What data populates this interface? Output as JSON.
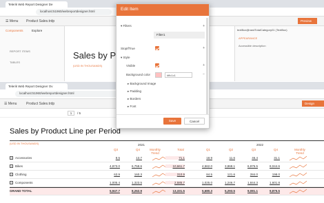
{
  "back_browser": {
    "tab": "Telerik Web Report Designer De",
    "url": "localhost:51960/webreportdesigner.html"
  },
  "back_app": {
    "menu": "Menu",
    "doc": "Product Sales.trdp",
    "left_tabs": [
      "Components",
      "Explore"
    ],
    "report_items": "REPORT ITEMS",
    "tables": "TABLES",
    "title": "Sales by Product",
    "subtitle": "(USD IN THOUSANDS)",
    "preview": "Preview",
    "panel_title": "textBox@randTotalCategory01 (TextBox)",
    "appearance": "APPEARANCE",
    "accessible": "Accessible description"
  },
  "front_browser": {
    "tab": "Telerik Web Report Designer Ov",
    "url": "localhost:51960/webreportdesigner.html"
  },
  "viewer": {
    "menu": "Menu",
    "doc": "Product Sales.trdp",
    "page": "1",
    "page_total": "/ 5",
    "design": "Design"
  },
  "report": {
    "title": "Sales by Product Line per Period",
    "currency": "(USD IN THOUSANDS)",
    "year1": "2021",
    "year2": "2022",
    "col_headers": [
      "Q3",
      "Q4",
      "Monthly Trend",
      "Total",
      "Q1",
      "Q2",
      "Q3",
      "Q4",
      "Monthly Trend"
    ],
    "rows": [
      {
        "label": "Accessories",
        "values": [
          "8.5",
          "13.7",
          "",
          "71.1",
          "18.9",
          "11.6",
          "46.4",
          "31.1"
        ]
      },
      {
        "label": "Bikes",
        "values": [
          "4,873.0",
          "6,758.6",
          "",
          "10,661.7",
          "4,562.0",
          "3,868.1",
          "6,975.5",
          "8,044.6"
        ]
      },
      {
        "label": "Clothing",
        "values": [
          "63.9",
          "160.3",
          "",
          "310.9",
          "84.5",
          "121.6",
          "284.0",
          "198.0"
        ]
      },
      {
        "label": "Components",
        "values": [
          "1,005.4",
          "1,323.5",
          "",
          "2,585.7",
          "1,025.0",
          "1,246.7",
          "1,844.3",
          "1,601.8"
        ]
      }
    ],
    "total": {
      "label": "GRAND TOTAL",
      "values": [
        "5,947.7",
        "8,262.9",
        "",
        "13,331.5",
        "5,680.3",
        "5,293.5",
        "9,081.1",
        "9,875.5"
      ]
    }
  },
  "dialog": {
    "title": "Edit Item",
    "filters": "Filters",
    "filter1": "Filter1",
    "stop_if_true": "StopIfTrue",
    "style": "Style",
    "visible": "Visible",
    "bg_color_label": "Background color",
    "bg_color_value": "#ffc1c1",
    "bg_color": "#ffc1c1",
    "sub_items": [
      "Background Image",
      "Padding",
      "Borders",
      "Font"
    ],
    "save": "Save",
    "cancel": "Cancel"
  }
}
